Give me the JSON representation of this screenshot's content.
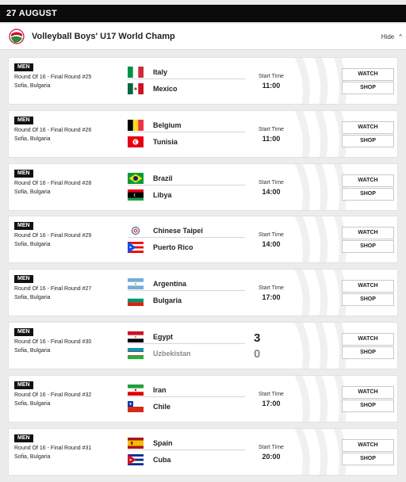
{
  "date": "27 AUGUST",
  "competition": {
    "title": "Volleyball Boys' U17 World Champ",
    "hide": "Hide",
    "chevron": "^"
  },
  "labels": {
    "start_time": "Start Time",
    "watch": "WATCH",
    "shop": "SHOP"
  },
  "matches": [
    {
      "category": "MEN",
      "round": "Round Of 16 - Final Round #25",
      "venue": "Sofia, Bulgaria",
      "team1": {
        "name": "Italy",
        "flag": "italy"
      },
      "team2": {
        "name": "Mexico",
        "flag": "mexico"
      },
      "time": "11:00"
    },
    {
      "category": "MEN",
      "round": "Round Of 16 - Final Round #26",
      "venue": "Sofia, Bulgaria",
      "team1": {
        "name": "Belgium",
        "flag": "belgium"
      },
      "team2": {
        "name": "Tunisia",
        "flag": "tunisia"
      },
      "time": "11:00"
    },
    {
      "category": "MEN",
      "round": "Round Of 16 - Final Round #28",
      "venue": "Sofia, Bulgaria",
      "team1": {
        "name": "Brazil",
        "flag": "brazil"
      },
      "team2": {
        "name": "Libya",
        "flag": "libya"
      },
      "time": "14:00"
    },
    {
      "category": "MEN",
      "round": "Round Of 16 - Final Round #29",
      "venue": "Sofia, Bulgaria",
      "team1": {
        "name": "Chinese Taipei",
        "flag": "chinese-taipei"
      },
      "team2": {
        "name": "Puerto Rico",
        "flag": "puerto-rico"
      },
      "time": "14:00"
    },
    {
      "category": "MEN",
      "round": "Round Of 16 - Final Round #27",
      "venue": "Sofia, Bulgaria",
      "team1": {
        "name": "Argentina",
        "flag": "argentina"
      },
      "team2": {
        "name": "Bulgaria",
        "flag": "bulgaria"
      },
      "time": "17:00"
    },
    {
      "category": "MEN",
      "round": "Round Of 16 - Final Round #30",
      "venue": "Sofia, Bulgaria",
      "team1": {
        "name": "Egypt",
        "flag": "egypt",
        "score": "3"
      },
      "team2": {
        "name": "Uzbekistan",
        "flag": "uzbekistan",
        "score": "0"
      },
      "time": null
    },
    {
      "category": "MEN",
      "round": "Round Of 16 - Final Round #32",
      "venue": "Sofia, Bulgaria",
      "team1": {
        "name": "Iran",
        "flag": "iran"
      },
      "team2": {
        "name": "Chile",
        "flag": "chile"
      },
      "time": "17:00"
    },
    {
      "category": "MEN",
      "round": "Round Of 16 - Final Round #31",
      "venue": "Sofia, Bulgaria",
      "team1": {
        "name": "Spain",
        "flag": "spain"
      },
      "team2": {
        "name": "Cuba",
        "flag": "cuba"
      },
      "time": "20:00"
    }
  ]
}
